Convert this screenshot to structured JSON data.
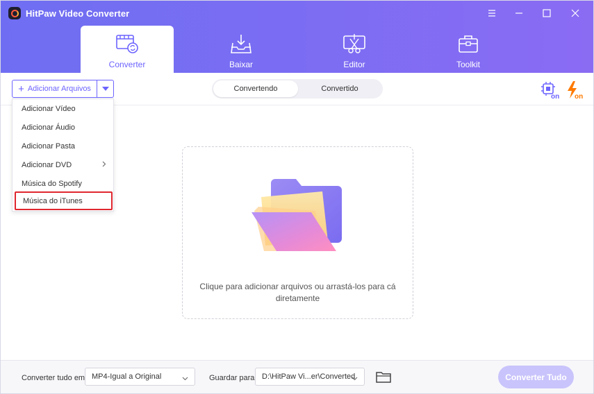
{
  "app": {
    "title": "HitPaw Video Converter"
  },
  "tabs": [
    {
      "label": "Converter",
      "icon": "film-convert-icon",
      "active": true
    },
    {
      "label": "Baixar",
      "icon": "download-tray-icon",
      "active": false
    },
    {
      "label": "Editor",
      "icon": "scissors-edit-icon",
      "active": false
    },
    {
      "label": "Toolkit",
      "icon": "toolbox-icon",
      "active": false
    }
  ],
  "toolbar": {
    "add_files_label": "Adicionar Arquivos",
    "add_files_plus": "+",
    "segment": [
      {
        "label": "Convertendo",
        "active": true
      },
      {
        "label": "Convertido",
        "active": false
      }
    ],
    "hardware_accel_text": "on",
    "lightning_text": "on"
  },
  "menu": {
    "items": [
      {
        "label": "Adicionar Vídeo"
      },
      {
        "label": "Adicionar Áudio"
      },
      {
        "label": "Adicionar Pasta"
      },
      {
        "label": "Adicionar DVD",
        "has_submenu": true
      },
      {
        "label": "Música do Spotify"
      },
      {
        "label": "Música do iTunes",
        "highlighted": true
      }
    ]
  },
  "dropzone": {
    "text": "Clique para adicionar arquivos ou arrastá-los para cá diretamente"
  },
  "bottom": {
    "convert_all_label": "Converter tudo em:",
    "format_value": "MP4-Igual a Original",
    "save_to_label": "Guardar para:",
    "path_value": "D:\\HitPaw Vi...er\\Converted",
    "convert_all_button": "Converter Tudo"
  },
  "colors": {
    "accent": "#6c63ff",
    "header_gradient_start": "#6f6ef2",
    "header_gradient_end": "#8a6cf3",
    "highlight_border": "#e0262e",
    "lightning": "#ff7a00",
    "convert_disabled": "#c9c4fb"
  }
}
